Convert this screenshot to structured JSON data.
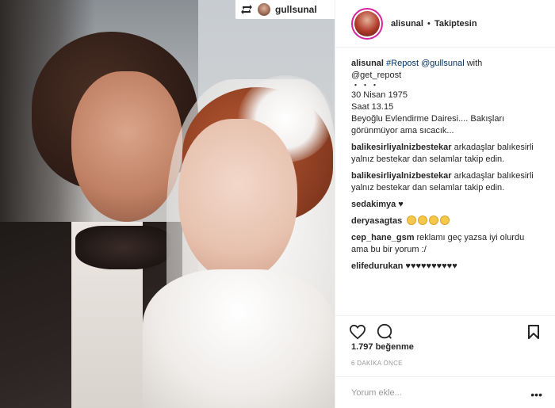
{
  "photo": {
    "repost_badge": {
      "icon": "repost-icon",
      "username": "gullsunal"
    }
  },
  "post_header": {
    "username": "alisunal",
    "separator": "•",
    "follow_status": "Takiptesin"
  },
  "caption": {
    "username": "alisunal",
    "hashtag": "#Repost",
    "mention": "@gullsunal",
    "with_text": "with",
    "mention2": "@get_repost",
    "dots": "・・・",
    "date": "30 Nisan 1975",
    "time": "Saat 13.15",
    "text": "Beyoğlu Evlendirme Dairesi.... Bakışları görünmüyor ama sıcacık..."
  },
  "comments": [
    {
      "user": "balikesirliyalnizbestekar",
      "text": "arkadaşlar balıkesirli yalnız bestekar dan selamlar takip edin."
    },
    {
      "user": "balikesirliyalnizbestekar",
      "text": "arkadaşlar balıkesirli yalnız bestekar dan selamlar takip edin."
    },
    {
      "user": "sedakimya",
      "text": "♥"
    },
    {
      "user": "deryasagtas",
      "emoji_count": 4
    },
    {
      "user": "cep_hane_gsm",
      "text": "reklamı geç yazsa iyi olurdu ama bu bir yorum :/"
    },
    {
      "user": "elifedurukan",
      "text": "♥♥♥♥♥♥♥♥♥♥"
    }
  ],
  "actions": {
    "like_icon": "heart-icon",
    "comment_icon": "comment-icon",
    "save_icon": "bookmark-icon"
  },
  "likes_text": "1.797 beğenme",
  "timestamp": "6 DAKİKA ÖNCE",
  "comment_input": {
    "placeholder": "Yorum ekle..."
  },
  "more_icon_text": "•••"
}
